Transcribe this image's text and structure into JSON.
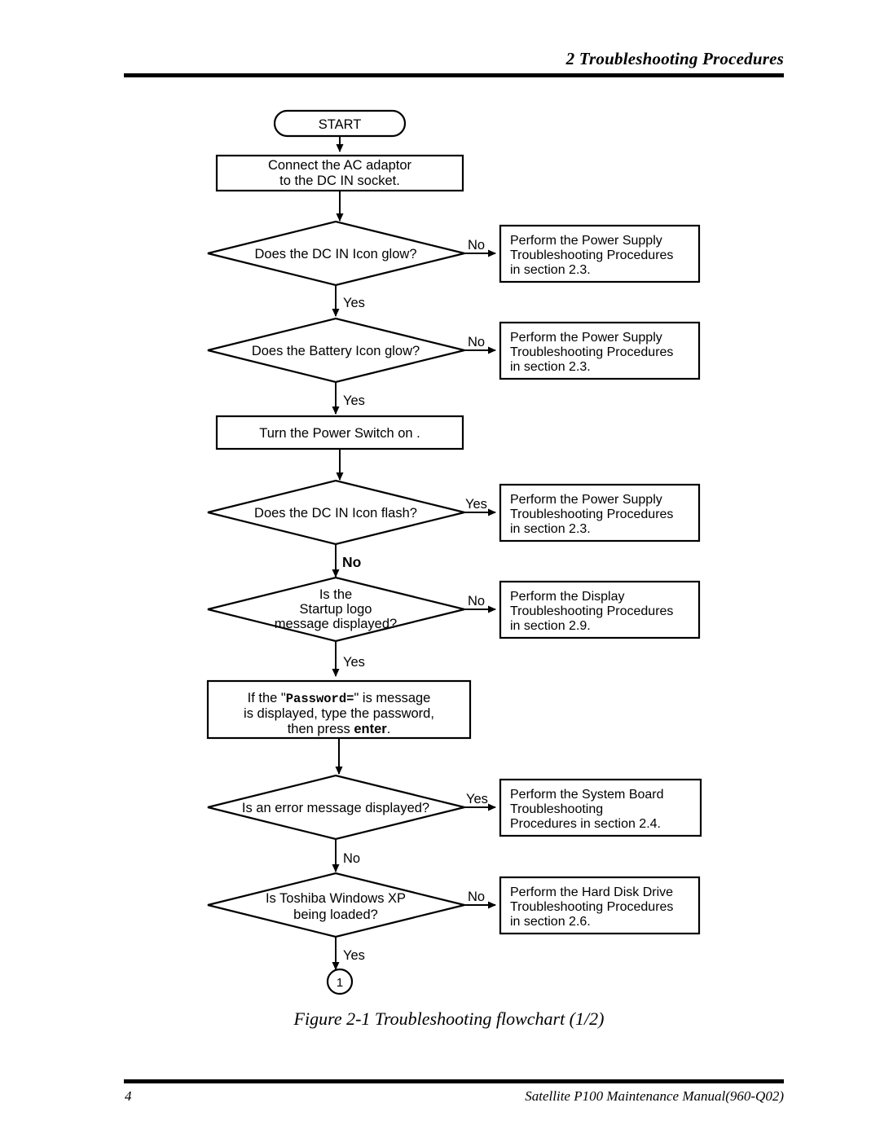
{
  "header": {
    "title": "2 Troubleshooting Procedures"
  },
  "figure": {
    "caption": "Figure 2-1  Troubleshooting flowchart (1/2)"
  },
  "footer": {
    "page_number": "4",
    "manual": "Satellite P100 Maintenance Manual(960-Q02)"
  },
  "flowchart": {
    "start": {
      "label": "START"
    },
    "process_1": {
      "line1": "Connect the AC adaptor",
      "line2": "to the DC IN socket."
    },
    "decision_1": {
      "text": "Does the DC IN Icon glow?",
      "branch_right": "No",
      "branch_down": "Yes"
    },
    "action_1": {
      "line1": "Perform the Power Supply",
      "line2": "Troubleshooting Procedures",
      "line3": "in section 2.3."
    },
    "decision_2": {
      "text": "Does the Battery Icon glow?",
      "branch_right": "No",
      "branch_down": "Yes"
    },
    "action_2": {
      "line1": "Perform the Power Supply",
      "line2": "Troubleshooting Procedures",
      "line3": "in section 2.3."
    },
    "process_2": {
      "line1": "Turn the Power Switch on ."
    },
    "decision_3": {
      "text": "Does the DC IN Icon flash?",
      "branch_right": "Yes",
      "branch_down": "No"
    },
    "action_3": {
      "line1": "Perform the Power Supply",
      "line2": "Troubleshooting Procedures",
      "line3": "in section 2.3."
    },
    "decision_4": {
      "line1": "Is the",
      "line2": "Startup logo",
      "line3": "message displayed?",
      "branch_right": "No",
      "branch_down": "Yes"
    },
    "action_4": {
      "line1": "Perform the Display",
      "line2": "Troubleshooting Procedures",
      "line3": "in section 2.9."
    },
    "process_3": {
      "line1_part1": "If the \"",
      "line1_code": "Password=",
      "line1_part2": "\" is message",
      "line2": "is displayed, type the password,",
      "line3_part1": "then press ",
      "line3_bold": "enter",
      "line3_part2": "."
    },
    "decision_5": {
      "text": "Is an error message displayed?",
      "branch_right": "Yes",
      "branch_down": "No"
    },
    "action_5": {
      "line1": "Perform the System Board",
      "line2": "Troubleshooting",
      "line3": "Procedures in section 2.4."
    },
    "decision_6": {
      "line1": "Is Toshiba Windows XP",
      "line2": "being loaded?",
      "branch_right": "No",
      "branch_down": "Yes"
    },
    "action_6": {
      "line1": "Perform the Hard Disk Drive",
      "line2": "Troubleshooting Procedures",
      "line3": "in section 2.6."
    },
    "connector": {
      "label": "1"
    }
  }
}
